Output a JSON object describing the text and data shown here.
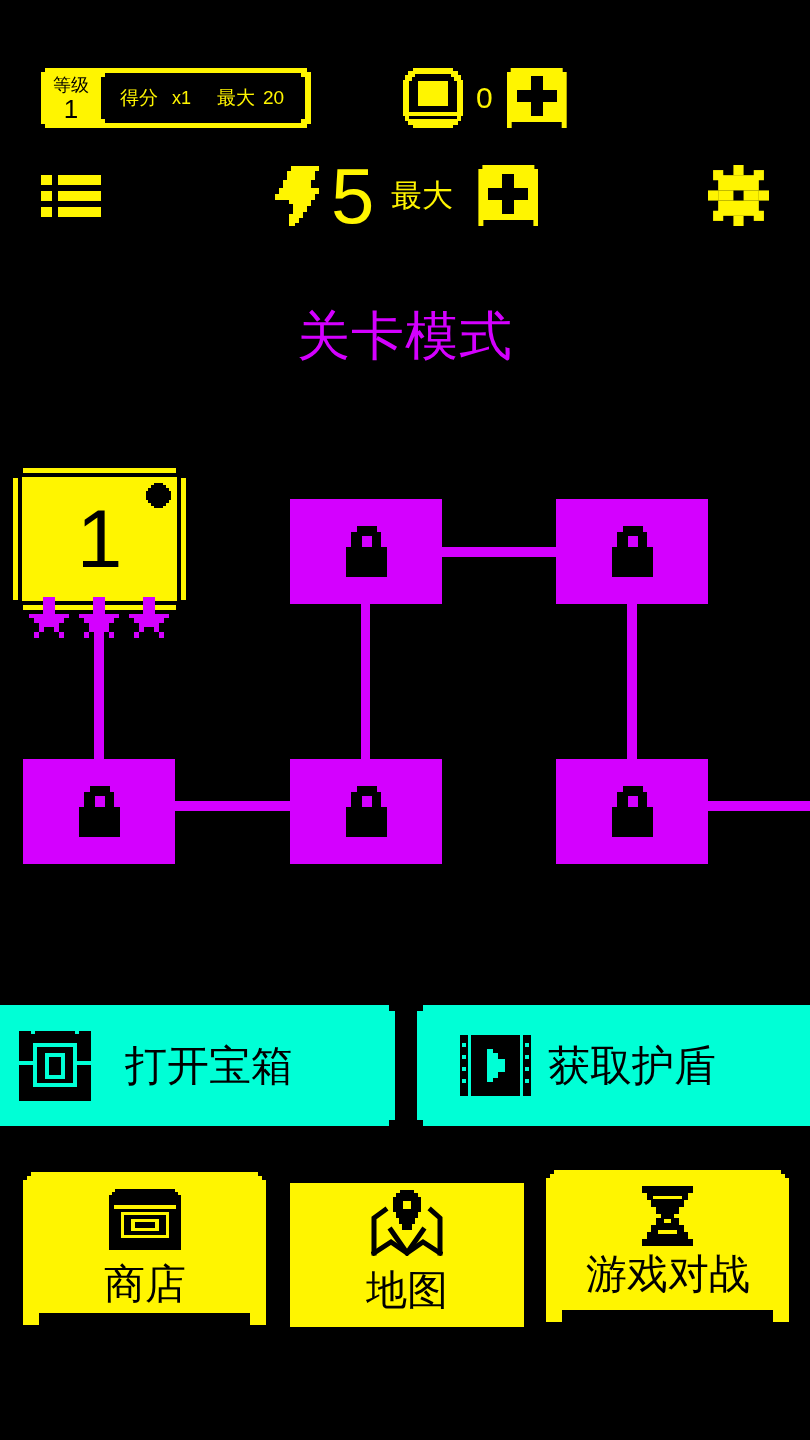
{
  "header": {
    "level": {
      "label": "等级",
      "value": "1"
    },
    "score": {
      "label": "得分",
      "multiplier": "x1",
      "max_label": "最大",
      "max": "20"
    },
    "coins": {
      "value": "0"
    }
  },
  "energy": {
    "value": "5",
    "max_label": "最大"
  },
  "title": "关卡模式",
  "levels": [
    {
      "label": "1",
      "locked": false,
      "selected": true,
      "stars": 3
    },
    {
      "locked": true,
      "selected": false
    },
    {
      "locked": true,
      "selected": false
    },
    {
      "locked": true,
      "selected": false
    },
    {
      "locked": true,
      "selected": false
    },
    {
      "locked": true,
      "selected": false
    }
  ],
  "actions": [
    {
      "kind": "chest",
      "label": "打开宝箱"
    },
    {
      "kind": "video",
      "label": "获取护盾"
    }
  ],
  "nav": [
    {
      "kind": "shop",
      "label": "商店",
      "selected": false
    },
    {
      "kind": "map",
      "label": "地图",
      "selected": true
    },
    {
      "kind": "battle",
      "label": "游戏对战",
      "selected": false
    }
  ]
}
